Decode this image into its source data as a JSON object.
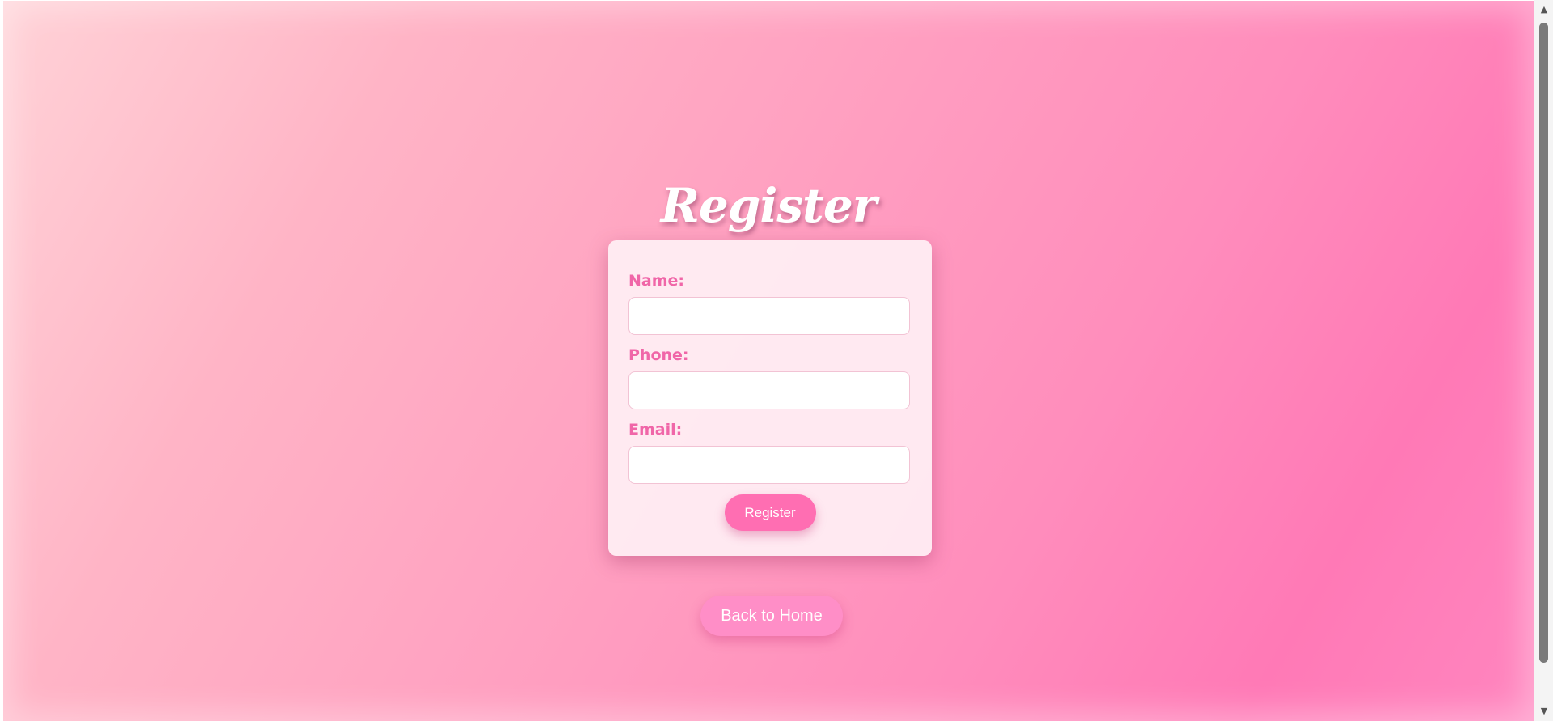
{
  "page": {
    "title": "Register"
  },
  "form": {
    "fields": [
      {
        "label": "Name:",
        "value": "",
        "placeholder": ""
      },
      {
        "label": "Phone:",
        "value": "",
        "placeholder": ""
      },
      {
        "label": "Email:",
        "value": "",
        "placeholder": ""
      }
    ],
    "submit_label": "Register"
  },
  "nav": {
    "back_label": "Back to Home"
  },
  "scrollbar": {
    "up_icon": "scroll-up-arrow",
    "down_icon": "scroll-down-arrow",
    "up_glyph": "▲",
    "down_glyph": "▼"
  },
  "colors": {
    "accent": "#ff6eb2",
    "label": "#f066a8",
    "card": "#fff0f5",
    "background_start": "#ffd2d7",
    "background_end": "#ff79b6"
  }
}
